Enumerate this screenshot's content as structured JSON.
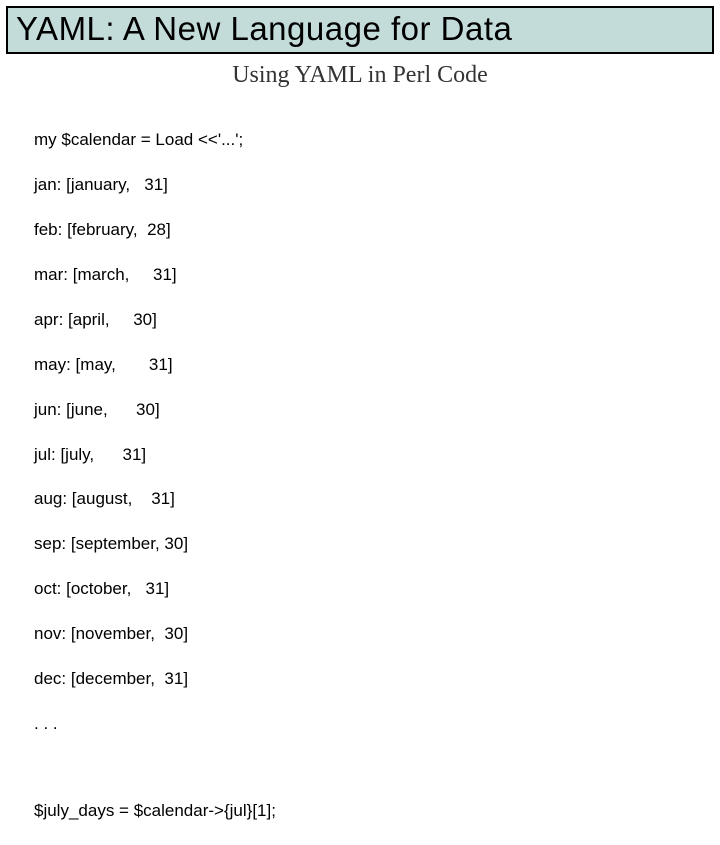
{
  "title": "YAML: A New Language for Data",
  "subtitle": "Using YAML in Perl Code",
  "code": {
    "line1": "my $calendar = Load <<'...';",
    "line2": "jan: [january,   31]",
    "line3": "feb: [february,  28]",
    "line4": "mar: [march,     31]",
    "line5": "apr: [april,     30]",
    "line6": "may: [may,       31]",
    "line7": "jun: [june,      30]",
    "line8": "jul: [july,      31]",
    "line9": "aug: [august,    31]",
    "line10": "sep: [september, 30]",
    "line11": "oct: [october,   31]",
    "line12": "nov: [november,  30]",
    "line13": "dec: [december,  31]",
    "line14": ". . .",
    "line15": "$july_days = $calendar->{jul}[1];"
  }
}
